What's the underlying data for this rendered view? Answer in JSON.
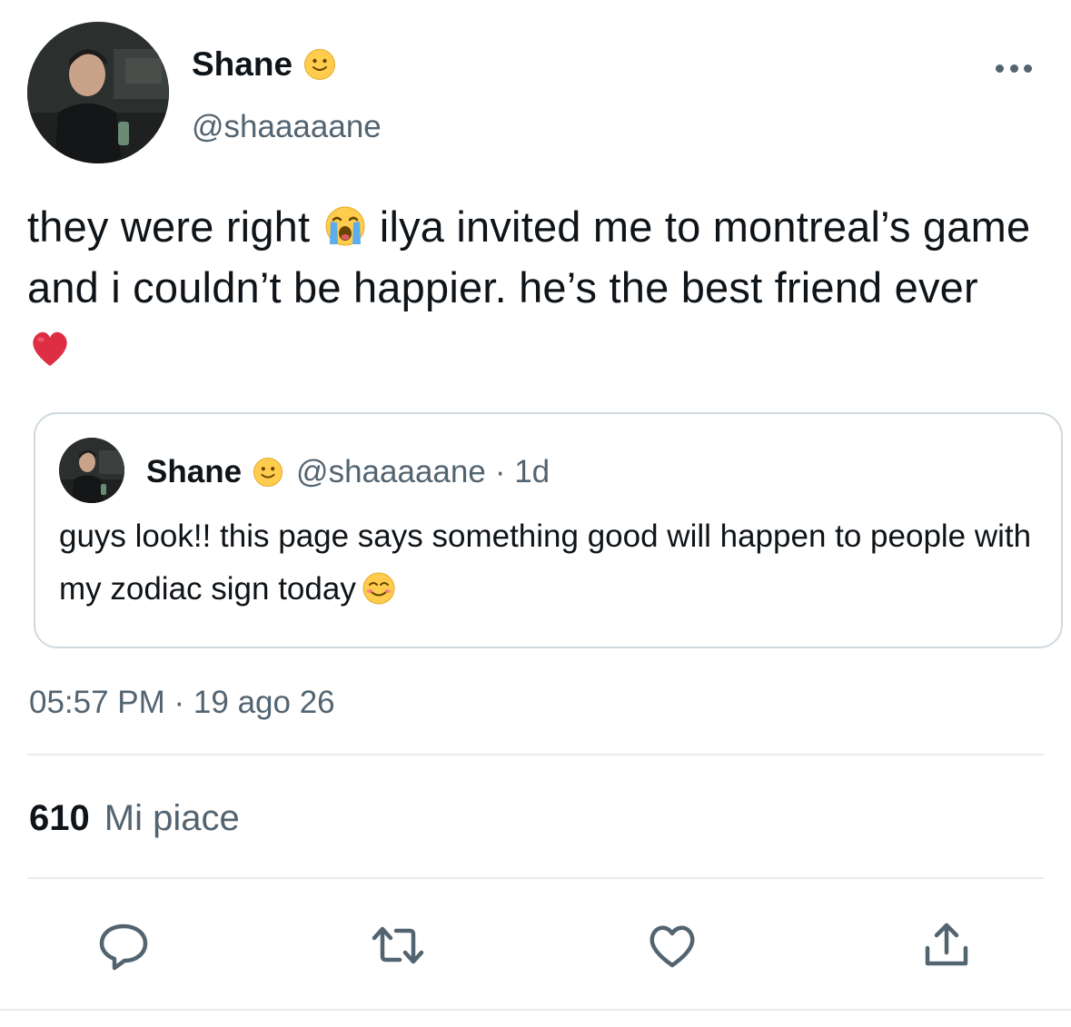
{
  "author": {
    "display_name": "Shane",
    "handle": "@shaaaaane",
    "avatar_icon": "profile-photo-avatar",
    "badge_icon": "slightly-smiling-face-emoji"
  },
  "tweet": {
    "text_1": "they were right",
    "text_2": " ilya invited me to montreal’s game and i couldn’t be happier. he’s the best friend ever",
    "emoji_1": "loudly-crying-face-emoji",
    "emoji_2": "red-heart-emoji"
  },
  "quote": {
    "display_name": "Shane",
    "handle": "@shaaaaane",
    "age": "· 1d",
    "text": "guys look!! this page says something good will happen to people with my zodiac sign today",
    "emoji": "smiling-face-with-smiling-eyes-emoji"
  },
  "meta": {
    "timestamp": "05:57 PM · 19 ago 26"
  },
  "stats": {
    "likes_count": "610",
    "likes_label": "Mi piace"
  },
  "actions": {
    "reply_icon": "reply-icon",
    "retweet_icon": "retweet-icon",
    "like_icon": "heart-icon",
    "share_icon": "share-icon"
  },
  "colors": {
    "text_primary": "#0f1419",
    "text_secondary": "#536471",
    "border": "#cfd9de",
    "divider": "#e6ecf0"
  }
}
